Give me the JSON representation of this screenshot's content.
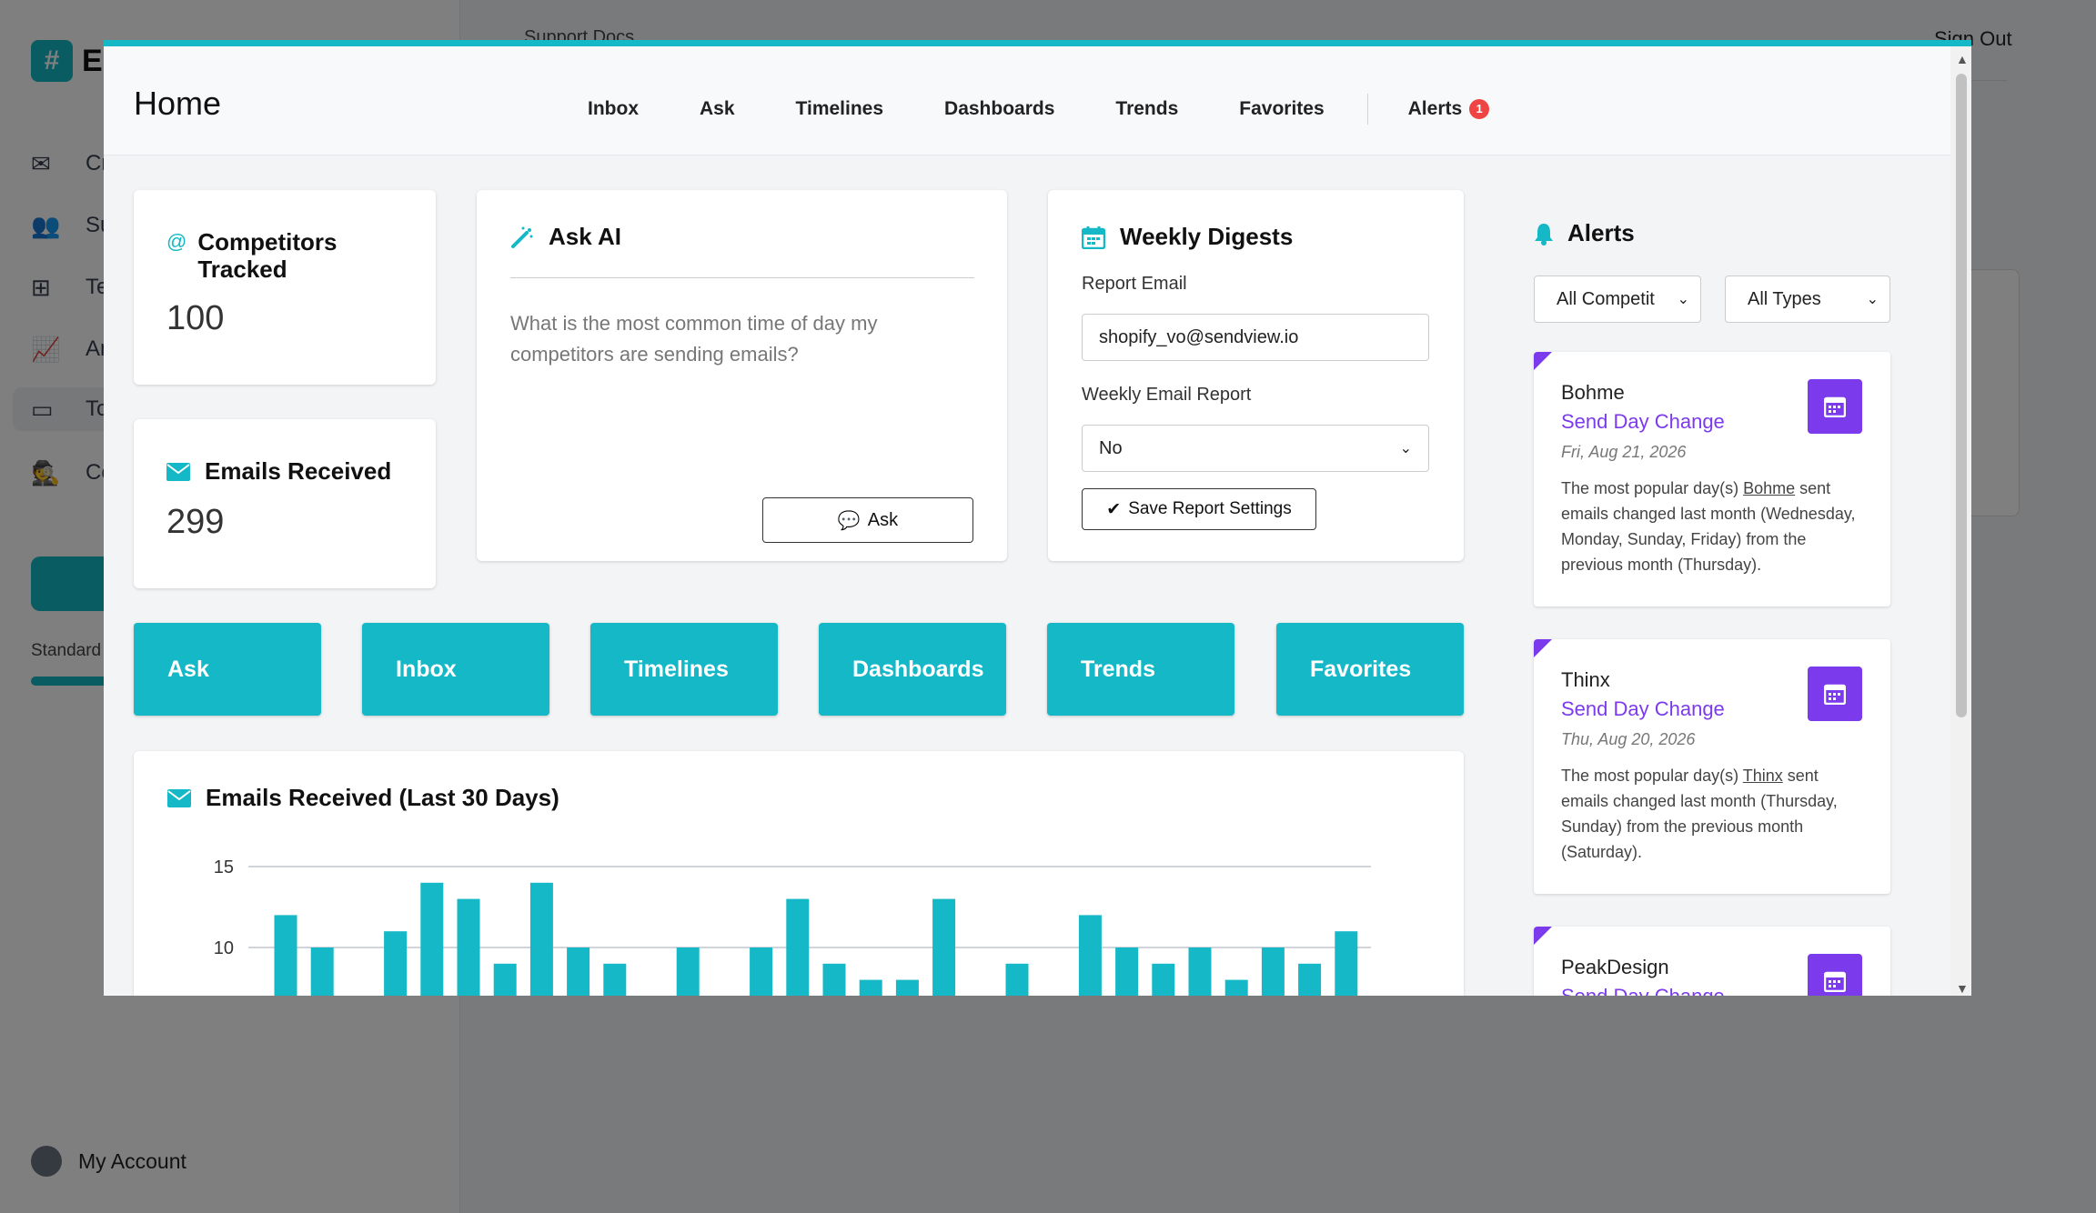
{
  "background": {
    "brand_initial": "E",
    "nav_items": [
      {
        "icon": "envelope-icon",
        "label": "Cre"
      },
      {
        "icon": "users-icon",
        "label": "Sub"
      },
      {
        "icon": "sitemap-icon",
        "label": "Ter"
      },
      {
        "icon": "chart-line-icon",
        "label": "Ana"
      },
      {
        "icon": "inbox-icon",
        "label": "Too"
      },
      {
        "icon": "user-secret-icon",
        "label": "Co"
      }
    ],
    "plan_label": "Standard",
    "account_label": "My Account",
    "top_link": "Support Docs",
    "sign_out": "Sign Out"
  },
  "header": {
    "title": "Home",
    "nav": [
      "Inbox",
      "Ask",
      "Timelines",
      "Dashboards",
      "Trends",
      "Favorites"
    ],
    "alerts_label": "Alerts",
    "alerts_count": "1"
  },
  "stats": {
    "competitors": {
      "label": "Competitors Tracked",
      "value": "100"
    },
    "emails": {
      "label": "Emails Received",
      "value": "299"
    }
  },
  "ask_ai": {
    "title": "Ask AI",
    "placeholder": "What is the most common time of day my competitors are sending emails?",
    "button": "Ask"
  },
  "digests": {
    "title": "Weekly Digests",
    "email_label": "Report Email",
    "email_value": "shopify_vo@sendview.io",
    "report_label": "Weekly Email Report",
    "report_value": "No",
    "save_button": "Save Report Settings"
  },
  "quick_buttons": [
    "Ask",
    "Inbox",
    "Timelines",
    "Dashboards",
    "Trends",
    "Favorites"
  ],
  "alerts_panel": {
    "title": "Alerts",
    "filter_competitor": "All Competit",
    "filter_type": "All Types",
    "items": [
      {
        "name": "Bohme",
        "type": "Send Day Change",
        "date": "Fri, Aug 21, 2026",
        "pre": "The most popular day(s) ",
        "link": "Bohme",
        "post": " sent emails changed last month (Wednesday, Monday, Sunday, Friday) from the previous month (Thursday)."
      },
      {
        "name": "Thinx",
        "type": "Send Day Change",
        "date": "Thu, Aug 20, 2026",
        "pre": "The most popular day(s) ",
        "link": "Thinx",
        "post": " sent emails changed last month (Thursday, Sunday) from the previous month (Saturday)."
      },
      {
        "name": "PeakDesign",
        "type": "Send Day Change",
        "date": "",
        "pre": "",
        "link": "",
        "post": ""
      }
    ]
  },
  "colors": {
    "accent": "#14b8c6",
    "alert": "#7c3aed",
    "badge": "#ef4444"
  },
  "chart_data": {
    "type": "bar",
    "title": "Emails Received (Last 30 Days)",
    "y_ticks": [
      "15",
      "10"
    ],
    "ylim": [
      0,
      15
    ],
    "grid": true,
    "values": [
      12,
      10,
      0,
      11,
      14,
      13,
      9,
      14,
      10,
      9,
      7,
      10,
      0,
      10,
      13,
      9,
      8,
      8,
      13,
      7,
      9,
      7,
      12,
      10,
      9,
      10,
      8,
      10,
      9,
      11
    ]
  }
}
